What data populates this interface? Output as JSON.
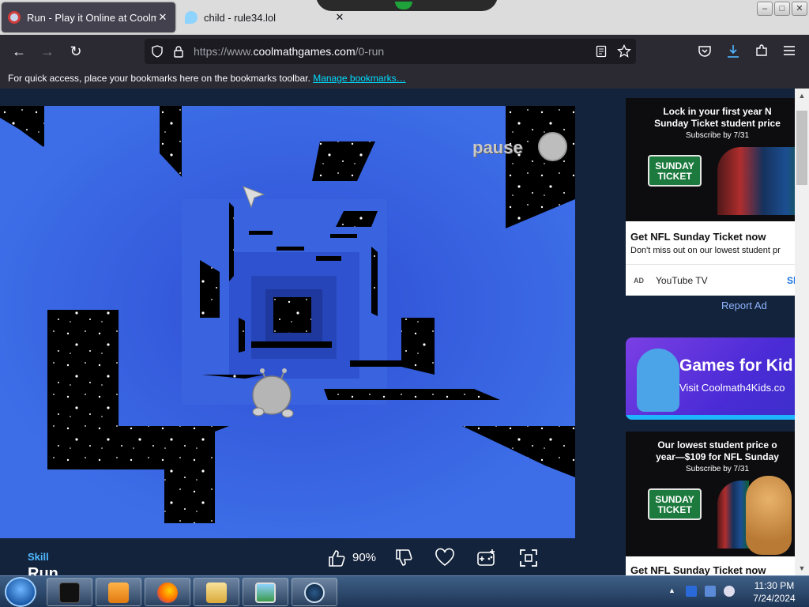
{
  "browser": {
    "tabs": [
      {
        "title": "Run - Play it Online at Coolmat",
        "active": true,
        "close": "✕"
      },
      {
        "title": "child - rule34.lol",
        "active": false,
        "close": "✕"
      }
    ],
    "window_controls": {
      "minimize": "–",
      "maximize": "□",
      "close": "✕"
    },
    "nav": {
      "back": "←",
      "forward": "→",
      "reload": "↻"
    },
    "url": {
      "prefix": "https://www.",
      "domain": "coolmathgames.com",
      "path": "/0-run"
    },
    "bookmarks_bar": {
      "message": "For quick access, place your bookmarks here on the bookmarks toolbar.",
      "link": "Manage bookmarks…"
    }
  },
  "game": {
    "pause_label": "pause",
    "category": "Skill",
    "name": "Run",
    "rating": "90%"
  },
  "ads": {
    "ad1": {
      "headline": "Lock in your first year N",
      "headline2": "Sunday Ticket student price",
      "deadline": "Subscribe by 7/31",
      "ticket_line1": "SUNDAY",
      "ticket_line2": "TICKET",
      "title": "Get NFL Sunday Ticket now",
      "subtitle": "Don't miss out on our lowest student pr",
      "badge": "AD",
      "advertiser": "YouTube TV",
      "cta": "Sl"
    },
    "report": "Report Ad",
    "promo": {
      "headline": "Games for Kid",
      "subtitle": "Visit Coolmath4Kids.co"
    },
    "ad3": {
      "headline": "Our lowest student price o",
      "headline2": "year—$109 for NFL Sunday",
      "deadline": "Subscribe by 7/31",
      "ticket_line1": "SUNDAY",
      "ticket_line2": "TICKET",
      "title": "Get NFL Sunday Ticket now"
    }
  },
  "taskbar": {
    "time": "11:30 PM",
    "date": "7/24/2024",
    "apps": [
      "terminal",
      "media-player",
      "firefox",
      "file-explorer",
      "photos",
      "steam"
    ]
  },
  "colors": {
    "game_blue": "#3d6ee8",
    "page_bg": "#13233b",
    "link_cyan": "#00ddff",
    "skill_blue": "#4fb8ff"
  }
}
